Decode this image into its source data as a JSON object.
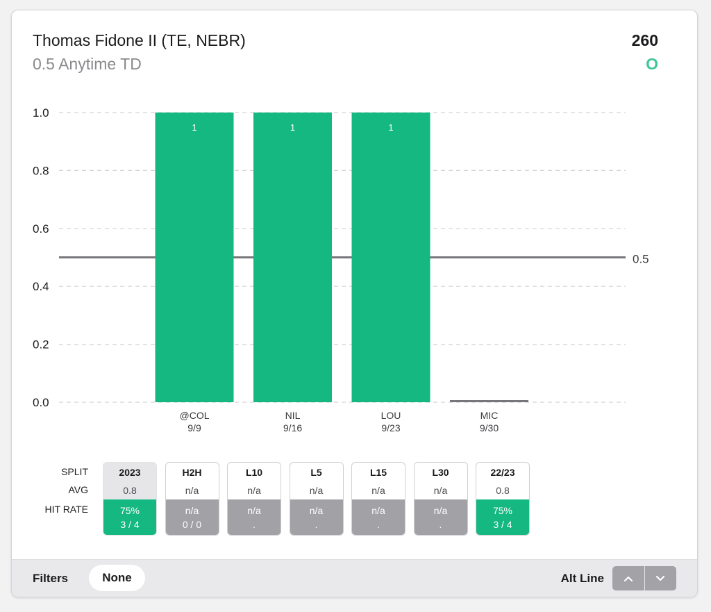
{
  "header": {
    "player": "Thomas Fidone II (TE, NEBR)",
    "prop": "0.5 Anytime TD",
    "odds": "260",
    "side": "O"
  },
  "colors": {
    "hit": "#15b881",
    "miss": "#a1a1a6",
    "line": "#77777b",
    "grid": "#d4d4d8"
  },
  "chart_data": {
    "type": "bar",
    "categories": [
      "@COL",
      "NIL",
      "LOU",
      "MIC"
    ],
    "dates": [
      "9/9",
      "9/16",
      "9/23",
      "9/30"
    ],
    "values": [
      1,
      1,
      1,
      0
    ],
    "data_labels": [
      "1",
      "1",
      "1",
      ""
    ],
    "ylim": [
      0,
      1.0
    ],
    "yticks": [
      "0.0",
      "0.2",
      "0.4",
      "0.6",
      "0.8",
      "1.0"
    ],
    "yticks_values": [
      0,
      0.2,
      0.4,
      0.6,
      0.8,
      1.0
    ],
    "line_value": 0.5,
    "line_label": "0.5",
    "grid": true
  },
  "splits": {
    "labels": {
      "split": "SPLIT",
      "avg": "AVG",
      "hit_rate": "HIT RATE"
    },
    "items": [
      {
        "name": "2023",
        "avg": "0.8",
        "pct": "75%",
        "frac": "3 / 4",
        "status": "good",
        "active": true
      },
      {
        "name": "H2H",
        "avg": "n/a",
        "pct": "n/a",
        "frac": "0 / 0",
        "status": "na",
        "active": false
      },
      {
        "name": "L10",
        "avg": "n/a",
        "pct": "n/a",
        "frac": ".",
        "status": "na",
        "active": false
      },
      {
        "name": "L5",
        "avg": "n/a",
        "pct": "n/a",
        "frac": ".",
        "status": "na",
        "active": false
      },
      {
        "name": "L15",
        "avg": "n/a",
        "pct": "n/a",
        "frac": ".",
        "status": "na",
        "active": false
      },
      {
        "name": "L30",
        "avg": "n/a",
        "pct": "n/a",
        "frac": ".",
        "status": "na",
        "active": false
      },
      {
        "name": "22/23",
        "avg": "0.8",
        "pct": "75%",
        "frac": "3 / 4",
        "status": "good",
        "active": false
      }
    ]
  },
  "footer": {
    "filters_label": "Filters",
    "filter_value": "None",
    "alt_line_label": "Alt Line",
    "up_icon": "chevron-up-icon",
    "down_icon": "chevron-down-icon"
  }
}
